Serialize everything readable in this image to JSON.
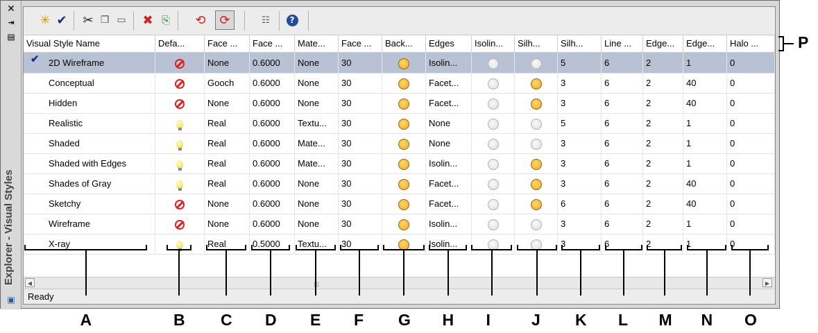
{
  "panel": {
    "title": "Explorer - Visual Styles",
    "side_buttons": [
      "close-icon",
      "auto-hide-icon",
      "properties-icon"
    ],
    "status_text": "Ready"
  },
  "toolbar": {
    "items": [
      "create-new-visual-style-icon",
      "apply-to-current-viewport-icon",
      "cut-icon",
      "copy-icon",
      "paste-icon",
      "delete-icon",
      "export-to-tool-palette-icon",
      "purge-icon",
      "purge-pressed-icon",
      "properties-icon",
      "help-icon"
    ]
  },
  "table": {
    "columns": [
      "Visual Style Name",
      "Defa...",
      "Face ...",
      "Face ...",
      "Mate...",
      "Face ...",
      "Back...",
      "Edges",
      "Isolin...",
      "Silh...",
      "Silh...",
      "Line ...",
      "Edge...",
      "Edge...",
      "Halo ..."
    ],
    "rows": [
      {
        "name": "2D Wireframe",
        "selected": true,
        "default": "no",
        "c1": "None",
        "c2": "0.6000",
        "c3": "None",
        "c4": "30",
        "back": "on",
        "edges": "Isolin...",
        "iso": "off",
        "silh": "off",
        "c5": "5",
        "c6": "6",
        "c7": "2",
        "c8": "1",
        "c9": "0"
      },
      {
        "name": "Conceptual",
        "selected": false,
        "default": "no",
        "c1": "Gooch",
        "c2": "0.6000",
        "c3": "None",
        "c4": "30",
        "back": "on",
        "edges": "Facet...",
        "iso": "off",
        "silh": "on",
        "c5": "3",
        "c6": "6",
        "c7": "2",
        "c8": "40",
        "c9": "0"
      },
      {
        "name": "Hidden",
        "selected": false,
        "default": "no",
        "c1": "None",
        "c2": "0.6000",
        "c3": "None",
        "c4": "30",
        "back": "on",
        "edges": "Facet...",
        "iso": "off",
        "silh": "on",
        "c5": "3",
        "c6": "6",
        "c7": "2",
        "c8": "40",
        "c9": "0"
      },
      {
        "name": "Realistic",
        "selected": false,
        "default": "bulb",
        "c1": "Real",
        "c2": "0.6000",
        "c3": "Textu...",
        "c4": "30",
        "back": "on",
        "edges": "None",
        "iso": "off",
        "silh": "off",
        "c5": "5",
        "c6": "6",
        "c7": "2",
        "c8": "1",
        "c9": "0"
      },
      {
        "name": "Shaded",
        "selected": false,
        "default": "bulb",
        "c1": "Real",
        "c2": "0.6000",
        "c3": "Mate...",
        "c4": "30",
        "back": "on",
        "edges": "None",
        "iso": "off",
        "silh": "off",
        "c5": "3",
        "c6": "6",
        "c7": "2",
        "c8": "1",
        "c9": "0"
      },
      {
        "name": "Shaded with Edges",
        "selected": false,
        "default": "bulb",
        "c1": "Real",
        "c2": "0.6000",
        "c3": "Mate...",
        "c4": "30",
        "back": "on",
        "edges": "Isolin...",
        "iso": "off",
        "silh": "on",
        "c5": "3",
        "c6": "6",
        "c7": "2",
        "c8": "1",
        "c9": "0"
      },
      {
        "name": "Shades of Gray",
        "selected": false,
        "default": "bulb",
        "c1": "Real",
        "c2": "0.6000",
        "c3": "None",
        "c4": "30",
        "back": "on",
        "edges": "Facet...",
        "iso": "off",
        "silh": "on",
        "c5": "3",
        "c6": "6",
        "c7": "2",
        "c8": "40",
        "c9": "0"
      },
      {
        "name": "Sketchy",
        "selected": false,
        "default": "no",
        "c1": "None",
        "c2": "0.6000",
        "c3": "None",
        "c4": "30",
        "back": "on",
        "edges": "Facet...",
        "iso": "off",
        "silh": "on",
        "c5": "6",
        "c6": "6",
        "c7": "2",
        "c8": "40",
        "c9": "0"
      },
      {
        "name": "Wireframe",
        "selected": false,
        "default": "no",
        "c1": "None",
        "c2": "0.6000",
        "c3": "None",
        "c4": "30",
        "back": "on",
        "edges": "Isolin...",
        "iso": "off",
        "silh": "off",
        "c5": "3",
        "c6": "6",
        "c7": "2",
        "c8": "1",
        "c9": "0"
      },
      {
        "name": "X-ray",
        "selected": false,
        "default": "bulb",
        "c1": "Real",
        "c2": "0.5000",
        "c3": "Textu...",
        "c4": "30",
        "back": "on",
        "edges": "Isolin...",
        "iso": "off",
        "silh": "off",
        "c5": "3",
        "c6": "6",
        "c7": "2",
        "c8": "1",
        "c9": "0"
      }
    ]
  },
  "callouts": [
    "A",
    "B",
    "C",
    "D",
    "E",
    "F",
    "G",
    "H",
    "I",
    "J",
    "K",
    "L",
    "M",
    "N",
    "O",
    "P"
  ],
  "colors": {
    "selected_row": "#b9c2d4",
    "no_icon": "#e02020",
    "check": "#1a2f8c",
    "on_light": "#f5a623"
  }
}
